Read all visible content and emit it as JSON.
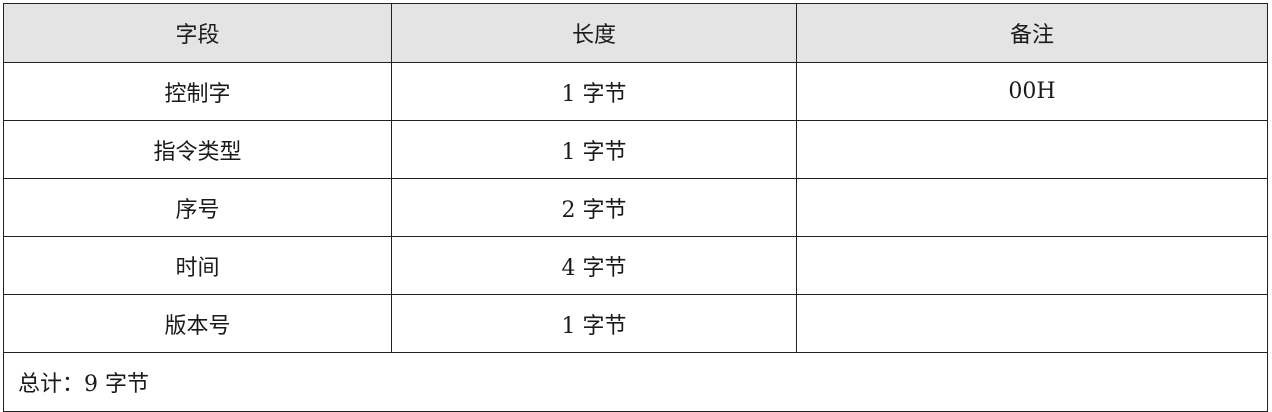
{
  "table": {
    "headers": [
      "字段",
      "长度",
      "备注"
    ],
    "rows": [
      {
        "field": "控制字",
        "length": "1 字节",
        "note": "00H"
      },
      {
        "field": "指令类型",
        "length": "1 字节",
        "note": ""
      },
      {
        "field": "序号",
        "length": "2 字节",
        "note": ""
      },
      {
        "field": "时间",
        "length": "4 字节",
        "note": ""
      },
      {
        "field": "版本号",
        "length": "1 字节",
        "note": ""
      }
    ],
    "total": "总计：9 字节"
  }
}
